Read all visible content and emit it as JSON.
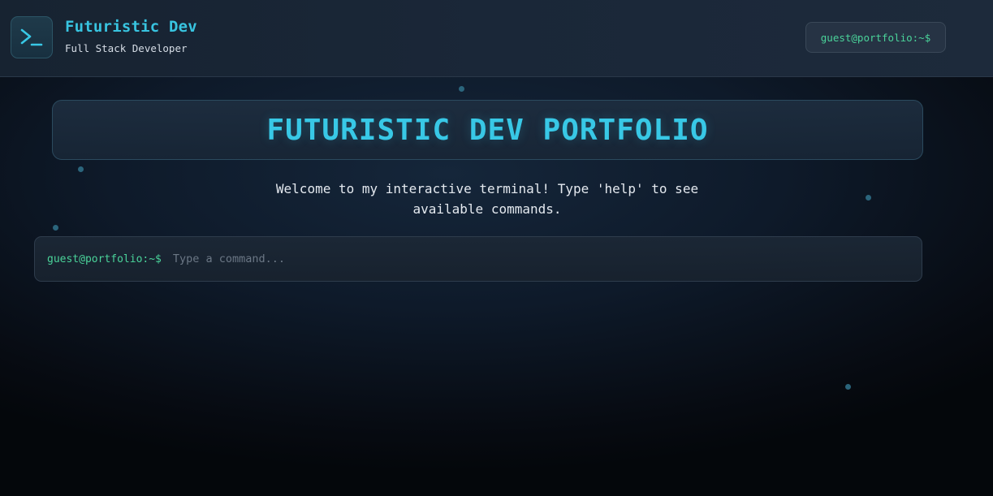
{
  "header": {
    "title": "Futuristic Dev",
    "subtitle": "Full Stack Developer",
    "prompt": "guest@portfolio:~$",
    "logo_icon": "terminal-icon"
  },
  "hero": {
    "title": "FUTURISTIC DEV PORTFOLIO",
    "welcome": "Welcome to my interactive terminal! Type 'help' to see available commands."
  },
  "terminal": {
    "prompt": "guest@portfolio:~$",
    "placeholder": "Type a command...",
    "value": ""
  },
  "colors": {
    "accent": "#38c8e6",
    "prompt_green": "#4ad39a",
    "background": "#0e1a2a"
  }
}
